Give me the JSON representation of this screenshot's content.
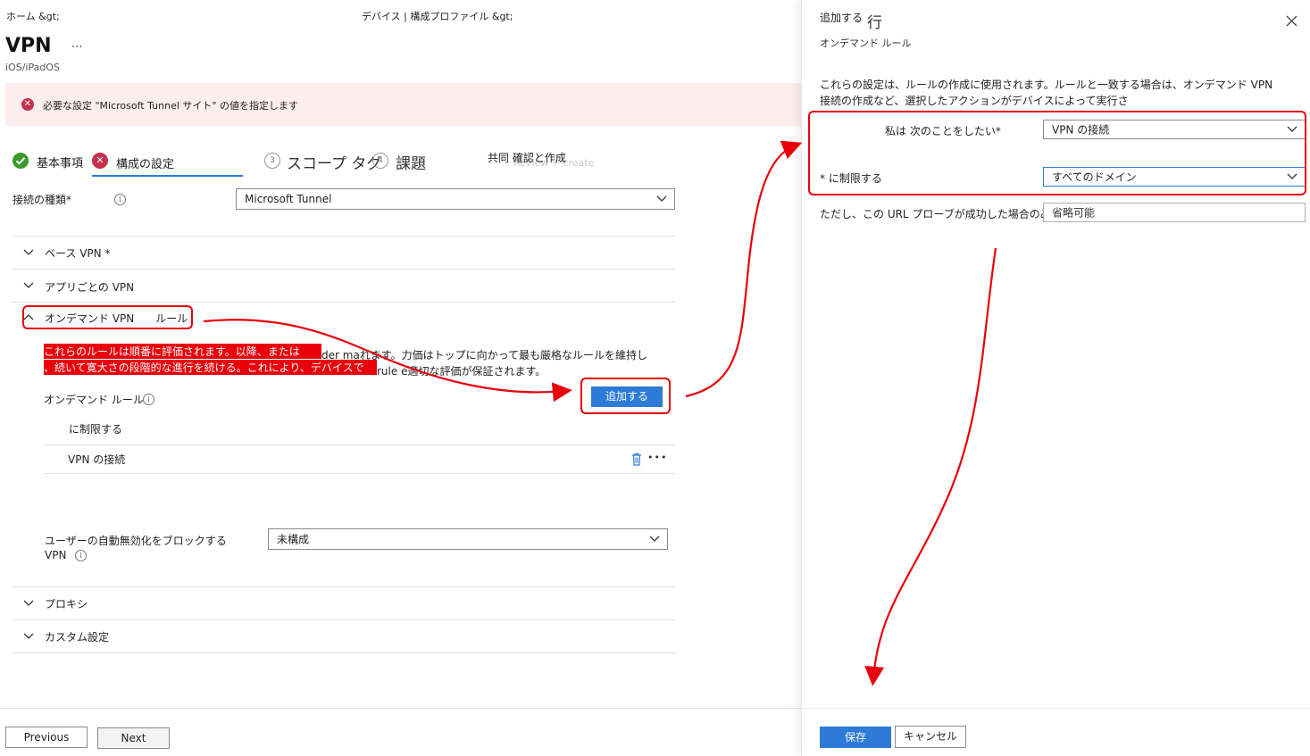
{
  "breadcrumb": {
    "home": "ホーム &gt;",
    "path": "デバイス | 構成プロファイル &gt;"
  },
  "header": {
    "title": "VPN",
    "more": "...",
    "platform": "iOS/iPadOS"
  },
  "error_banner": {
    "message": "必要な設定 \"Microsoft Tunnel サイト\" の値を指定します"
  },
  "steps": [
    {
      "label": "基本事項",
      "state": "done"
    },
    {
      "label": "構成の設定",
      "state": "error"
    },
    {
      "num": "3",
      "label": "スコープ タグ"
    },
    {
      "num": "4",
      "label": "課題"
    },
    {
      "label": "共同 確認と作成",
      "ghost": "Review + create"
    }
  ],
  "connection": {
    "label": "接続の種類*",
    "value": "Microsoft Tunnel"
  },
  "accordions": {
    "base_vpn": "ベース VPN *",
    "per_app_vpn": "アプリごとの VPN",
    "on_demand": "オンデマンド VPN　　ルール",
    "proxy": "プロキシ",
    "custom": "カスタム設定"
  },
  "on_demand": {
    "desc_line1_redacted": "これらのルールは順番に評価されます。以降、または",
    "desc_line1_rest": "der maれます。力価はトップに向かって最も厳格なルールを維持し",
    "desc_line2_redacted": "、続いて寛大さの段階的な進行を続ける。これにより、デバイスで",
    "desc_line2_rest": "rule e適切な評価が保証されます。",
    "rules_label": "オンデマンド ルール",
    "add_button": "追加する",
    "table_header": "に制限する",
    "row_value": "VPN の接続",
    "row_more": "•••"
  },
  "block_user": {
    "label_line1": "ユーザーの自動無効化をブロックする",
    "label_line2": "VPN",
    "value": "未構成"
  },
  "footer": {
    "previous": "Previous",
    "next": "Next"
  },
  "panel": {
    "title": "追加する",
    "title_suffix": "行",
    "subtitle": "オンデマンド ルール",
    "description_line1": "これらの設定は、ルールの作成に使用されます。ルールと一致する場合は、オンデマンド VPN",
    "description_line2": "接続の作成など、選択したアクションがデバイスによって実行さ",
    "field_action_label": "私は 次のことをしたい*",
    "field_action_value": "VPN の接続",
    "field_restrict_label": "* に制限する",
    "field_restrict_value": "すべてのドメイン",
    "field_probe_label": "ただし、この URL プローブが成功した場合のみ",
    "field_probe_value": "省略可能",
    "save": "保存",
    "cancel": "キャンセル"
  },
  "colors": {
    "accent": "#2d7bd6",
    "error": "#c4314b",
    "success": "#3a9a2a",
    "annotation": "#e8000b"
  }
}
